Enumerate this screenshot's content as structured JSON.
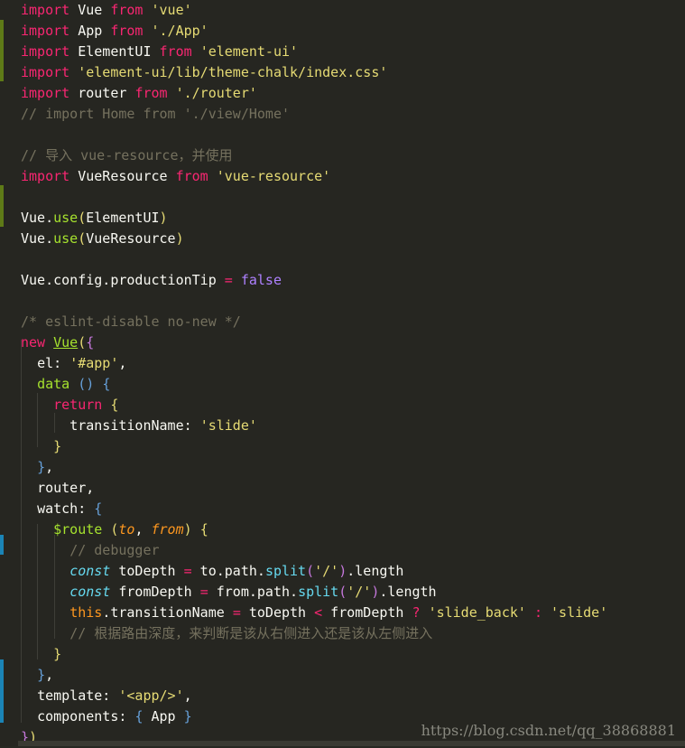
{
  "editor": {
    "language": "javascript",
    "lines": [
      "import Vue from 'vue'",
      "import App from './App'",
      "import ElementUI from 'element-ui'",
      "import 'element-ui/lib/theme-chalk/index.css'",
      "import router from './router'",
      "// import Home from './view/Home'",
      "",
      "// 导入 vue-resource，并使用",
      "import VueResource from 'vue-resource'",
      "",
      "Vue.use(ElementUI)",
      "Vue.use(VueResource)",
      "",
      "Vue.config.productionTip = false",
      "",
      "/* eslint-disable no-new */",
      "new Vue({",
      "  el: '#app',",
      "  data () {",
      "    return {",
      "      transitionName: 'slide'",
      "    }",
      "  },",
      "  router,",
      "  watch: {",
      "    $route (to, from) {",
      "      // debugger",
      "      const toDepth = to.path.split('/').length",
      "      const fromDepth = from.path.split('/').length",
      "      this.transitionName = toDepth < fromDepth ? 'slide_back' : 'slide'",
      "      // 根据路由深度，来判断是该从右侧进入还是该从左侧进入",
      "    }",
      "  },",
      "  template: '<app/>',",
      "  components: { App }",
      "})"
    ],
    "tokens": {
      "import": "import",
      "from": "from",
      "Vue": "Vue",
      "App": "App",
      "ElementUI": "ElementUI",
      "router": "router",
      "VueResource": "VueResource",
      "s_vue": "'vue'",
      "s_app": "'./App'",
      "s_element": "'element-ui'",
      "s_css": "'element-ui/lib/theme-chalk/index.css'",
      "s_router": "'./router'",
      "c_home": "// import Home from './view/Home'",
      "c_resource": "// 导入 vue-resource，并使用",
      "s_resource": "'vue-resource'",
      "use": "use",
      "config": "Vue.config.productionTip",
      "eq": "=",
      "false": "false",
      "c_eslint": "/* eslint-disable no-new */",
      "new": "new",
      "el": "el: ",
      "s_app_id": "'#app'",
      "data": "data",
      "return": "return",
      "transitionName": "transitionName: ",
      "s_slide": "'slide'",
      "router_prop": "router,",
      "watch": "watch: ",
      "route": "$route",
      "to": "to",
      "from_param": "from",
      "c_debugger": "// debugger",
      "const": "const",
      "toDepth": " toDepth ",
      "fromDepth": " fromDepth ",
      "to_path": " to.path.",
      "from_path": " from.path.",
      "split": "split",
      "s_slash": "'/'",
      "length": ".length",
      "this": "this",
      "this_rest": ".transitionName ",
      "cmp_left": " toDepth ",
      "lt": "<",
      "cmp_right": " fromDepth ",
      "q": "?",
      "s_slide_back": "'slide_back'",
      "colon": ":",
      "c_depth": "// 根据路由深度，来判断是该从右侧进入还是该从左侧进入",
      "template": "template: ",
      "s_template": "'<app/>'",
      "components": "components: ",
      "App_ref": " App "
    }
  },
  "watermark": "https://blog.csdn.net/qq_38868881"
}
